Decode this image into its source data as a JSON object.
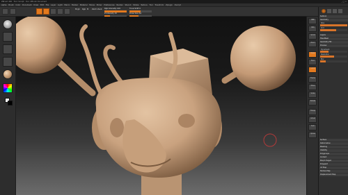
{
  "app": {
    "title": "ZBrush 4R2 · Tool: Sculpt · Doc: ZBrush Document",
    "window_buttons": "_ □ ×"
  },
  "menu": {
    "items": [
      "Alpha",
      "Brush",
      "Color",
      "Document",
      "Draw",
      "Edit",
      "File",
      "Layer",
      "Light",
      "Macro",
      "Marker",
      "Material",
      "Movie",
      "Picker",
      "Preferences",
      "Render",
      "Stencil",
      "Stroke",
      "Texture",
      "Tool",
      "Transform",
      "Zplugin",
      "Zscript"
    ]
  },
  "topshelf": {
    "mode_labels": [
      "Edit",
      "Draw",
      "Move",
      "Scale",
      "Rotate"
    ],
    "mrgb": "Mrgb",
    "rgb": "Rgb",
    "m": "M",
    "zadd": "Zadd",
    "zsub": "Zsub",
    "rgb_intensity": "Rgb Intensity 100",
    "z_intensity": "Z Intensity 25",
    "focal_shift": "Focal Shift 0",
    "draw_size": "Draw Size 64",
    "rgb_intensity_value": 1.0,
    "z_intensity_value": 0.25,
    "focal_shift_value": 0.5,
    "draw_size_value": 0.4
  },
  "leftbar": {
    "tools": [
      "brush-standard",
      "stroke-dots",
      "alpha-off",
      "texture-off",
      "material-skin",
      "color-picker"
    ],
    "main_color": "#ffffff",
    "secondary_color": "#000000",
    "accent": "#e2791e"
  },
  "rightshelf": {
    "buttons": [
      "BPR",
      "SPix",
      "Scroll",
      "Zoom",
      "Actual",
      "AAHalf",
      "Persp",
      "Floor",
      "Local",
      "Frame",
      "Move",
      "Scale",
      "Rotate",
      "Transp",
      "Ghost",
      "Solo",
      "Xpose"
    ]
  },
  "tray": {
    "sections": [
      "Subtool",
      "Geometry",
      "Layers",
      "FiberMesh",
      "Geometry HD",
      "Preview",
      "Surface",
      "Deformation",
      "Masking",
      "Visibility",
      "Polygroups",
      "Contact",
      "Morph Target",
      "Polypaint",
      "UV Map",
      "Texture Map",
      "Displacement Map"
    ],
    "sliders": [
      {
        "label": "SDiv",
        "value": 1.0
      },
      {
        "label": "Smt",
        "value": 0.6
      },
      {
        "label": "Dynamesh",
        "value": 0.3
      },
      {
        "label": "Resolution",
        "value": 0.5
      },
      {
        "label": "Blur",
        "value": 0.2
      }
    ]
  },
  "canvas": {
    "model": "Mouse-eared creature sculpt",
    "clay_color": "#c9a27f",
    "clay_shadow": "#7a5a3f",
    "cursor_color": "#b23a3a"
  }
}
